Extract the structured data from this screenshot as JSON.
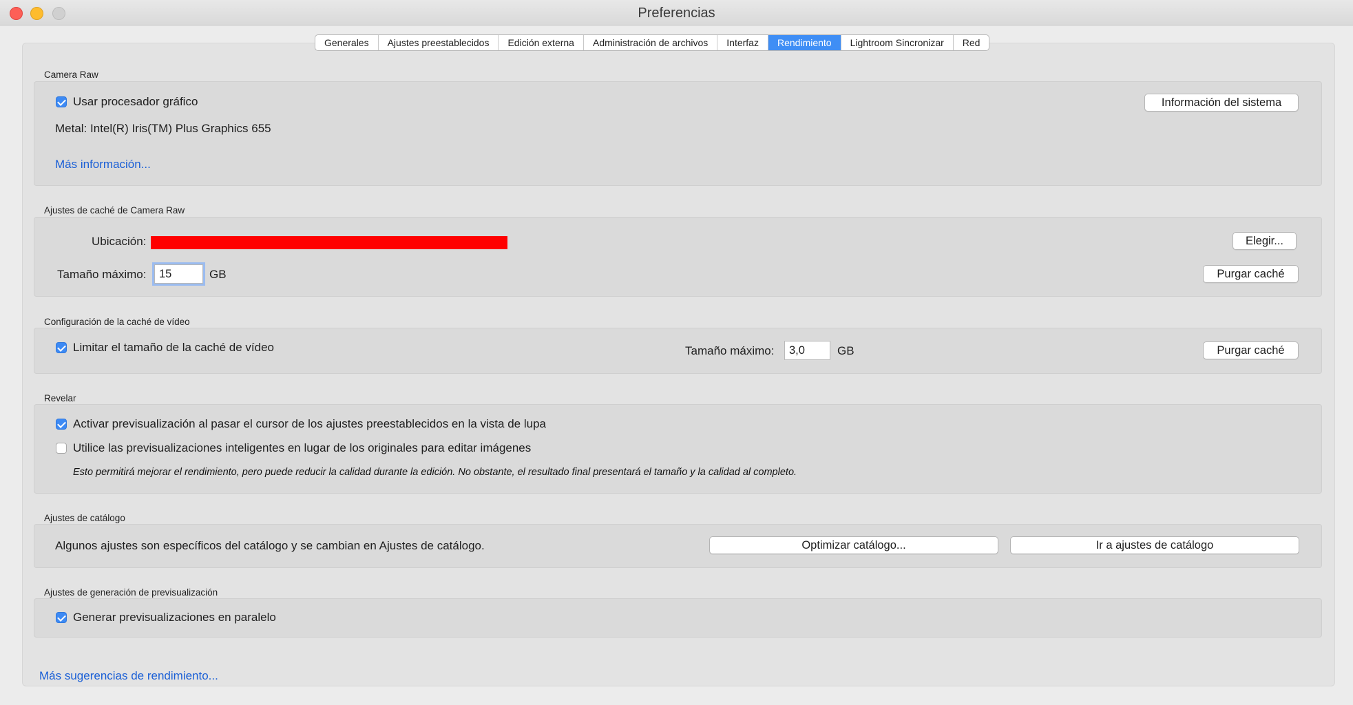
{
  "window": {
    "title": "Preferencias"
  },
  "tabs": [
    {
      "label": "Generales",
      "active": false
    },
    {
      "label": "Ajustes preestablecidos",
      "active": false
    },
    {
      "label": "Edición externa",
      "active": false
    },
    {
      "label": "Administración de archivos",
      "active": false
    },
    {
      "label": "Interfaz",
      "active": false
    },
    {
      "label": "Rendimiento",
      "active": true
    },
    {
      "label": "Lightroom Sincronizar",
      "active": false
    },
    {
      "label": "Red",
      "active": false
    }
  ],
  "camera_raw": {
    "heading": "Camera Raw",
    "use_gpu_label": "Usar procesador gráfico",
    "use_gpu_checked": true,
    "system_info_button": "Información del sistema",
    "gpu_info": "Metal: Intel(R) Iris(TM) Plus Graphics 655",
    "more_info_link": "Más información..."
  },
  "cache": {
    "heading": "Ajustes de caché de Camera Raw",
    "location_label": "Ubicación:",
    "choose_button": "Elegir...",
    "max_size_label": "Tamaño máximo:",
    "max_size_value": "15",
    "unit": "GB",
    "purge_button": "Purgar caché"
  },
  "video_cache": {
    "heading": "Configuración de la caché de vídeo",
    "limit_label": "Limitar el tamaño de la caché de vídeo",
    "limit_checked": true,
    "max_size_label": "Tamaño máximo:",
    "max_size_value": "3,0",
    "unit": "GB",
    "purge_button": "Purgar caché"
  },
  "develop": {
    "heading": "Revelar",
    "hover_preview_label": "Activar previsualización al pasar el cursor de los ajustes preestablecidos en la vista de lupa",
    "hover_preview_checked": true,
    "smart_previews_label": "Utilice las previsualizaciones inteligentes en lugar de los originales para editar imágenes",
    "smart_previews_checked": false,
    "note": "Esto permitirá mejorar el rendimiento, pero puede reducir la calidad durante la edición. No obstante, el resultado final presentará el tamaño y la calidad al completo."
  },
  "catalog": {
    "heading": "Ajustes de catálogo",
    "description": "Algunos ajustes son específicos del catálogo y se cambian en Ajustes de catálogo.",
    "optimize_button": "Optimizar catálogo...",
    "goto_button": "Ir a ajustes de catálogo"
  },
  "preview_gen": {
    "heading": "Ajustes de generación de previsualización",
    "parallel_label": "Generar previsualizaciones en paralelo",
    "parallel_checked": true
  },
  "footer": {
    "more_tips_link": "Más sugerencias de rendimiento..."
  }
}
